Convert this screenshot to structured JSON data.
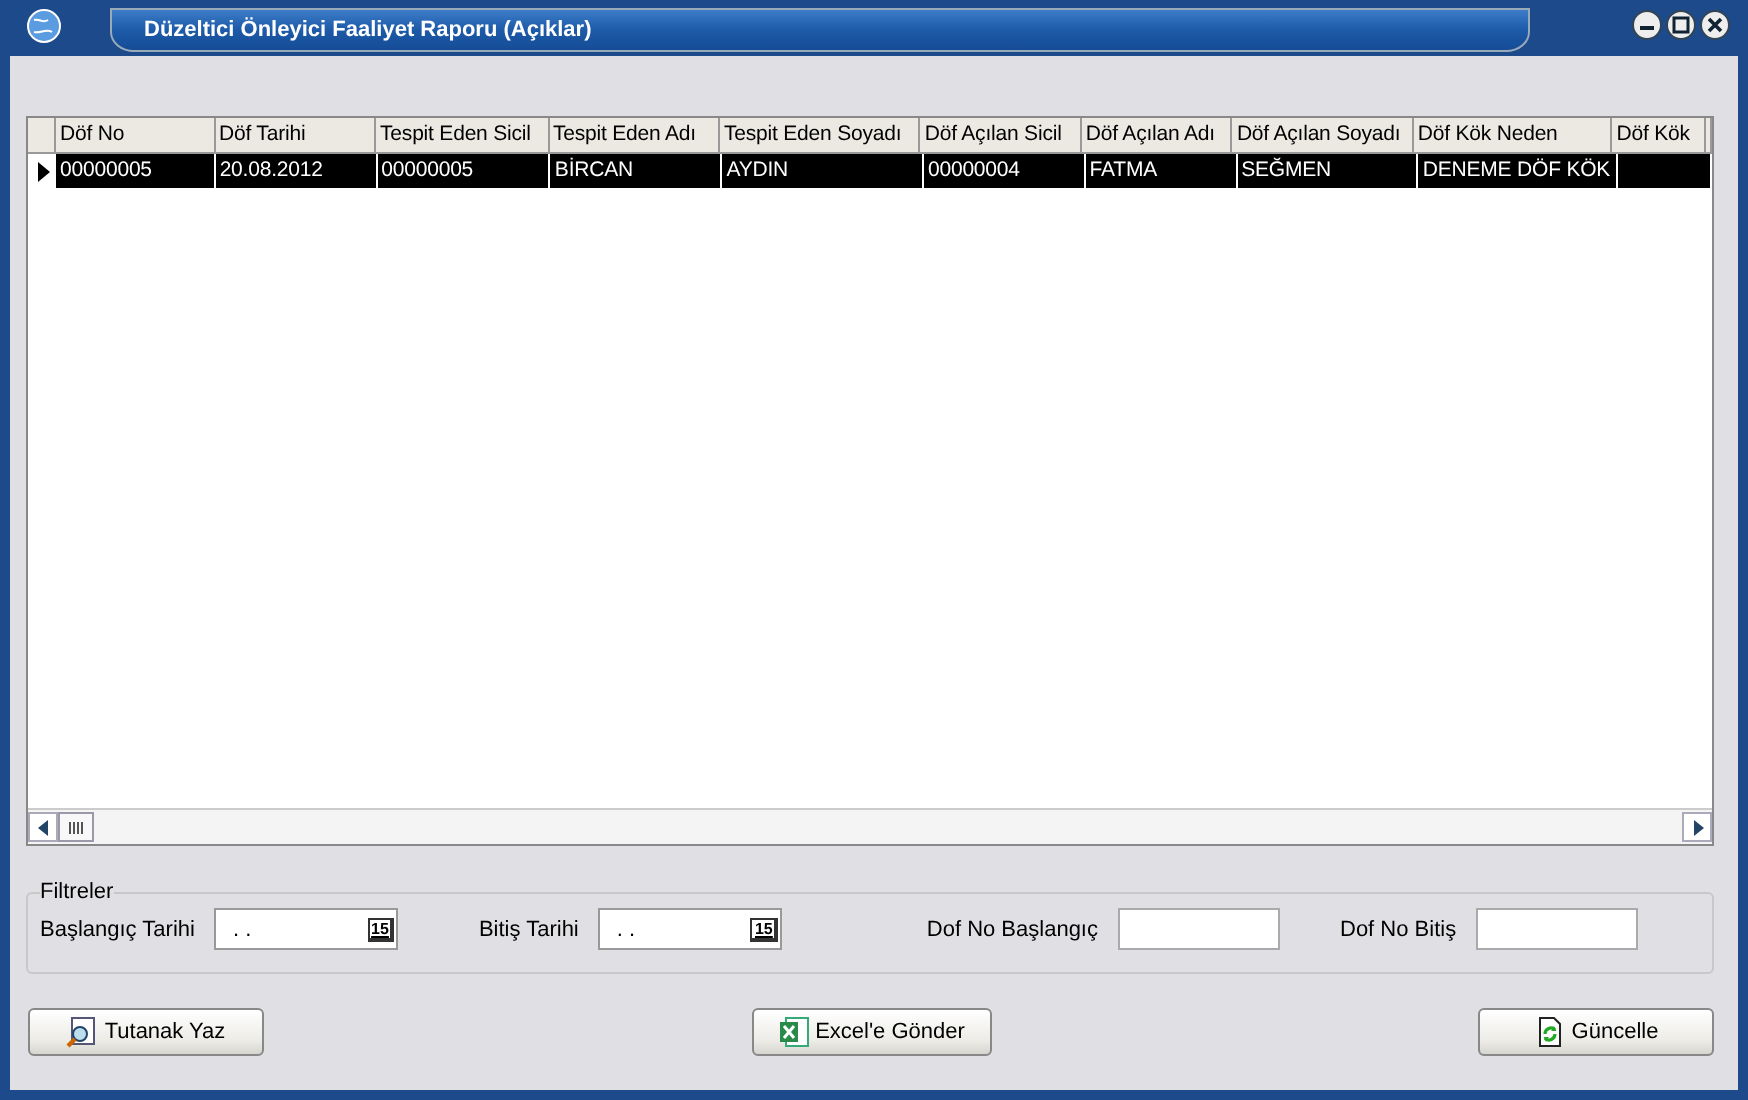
{
  "window": {
    "title": "Düzeltici Önleyici Faaliyet Raporu (Açıklar)"
  },
  "table": {
    "columns": [
      "Döf No",
      "Döf Tarihi",
      "Tespit Eden Sicil",
      "Tespit Eden Adı",
      "Tespit Eden Soyadı",
      "Döf Açılan Sicil",
      "Döf Açılan Adı",
      "Döf Açılan Soyadı",
      "Döf Kök Neden",
      "Döf Kök"
    ],
    "rows": [
      {
        "selected": true,
        "cells": [
          "00000005",
          "20.08.2012",
          "00000005",
          "BİRCAN",
          "AYDIN",
          "00000004",
          "FATMA",
          "SEĞMEN",
          "DENEME DÖF KÖK"
        ]
      }
    ]
  },
  "filters": {
    "title": "Filtreler",
    "fields": [
      {
        "kind": "date",
        "label": "Başlangıç Tarihi",
        "value": ". .",
        "calendar": "15"
      },
      {
        "kind": "date",
        "label": "Bitiş Tarihi",
        "value": ". .",
        "calendar": "15"
      },
      {
        "kind": "text",
        "label": "Dof No Başlangıç"
      },
      {
        "kind": "text",
        "label": "Dof No Bitiş"
      }
    ]
  },
  "buttons": [
    {
      "label": "Tutanak Yaz"
    },
    {
      "label": "Excel'e Gönder"
    },
    {
      "label": "Güncelle"
    }
  ]
}
